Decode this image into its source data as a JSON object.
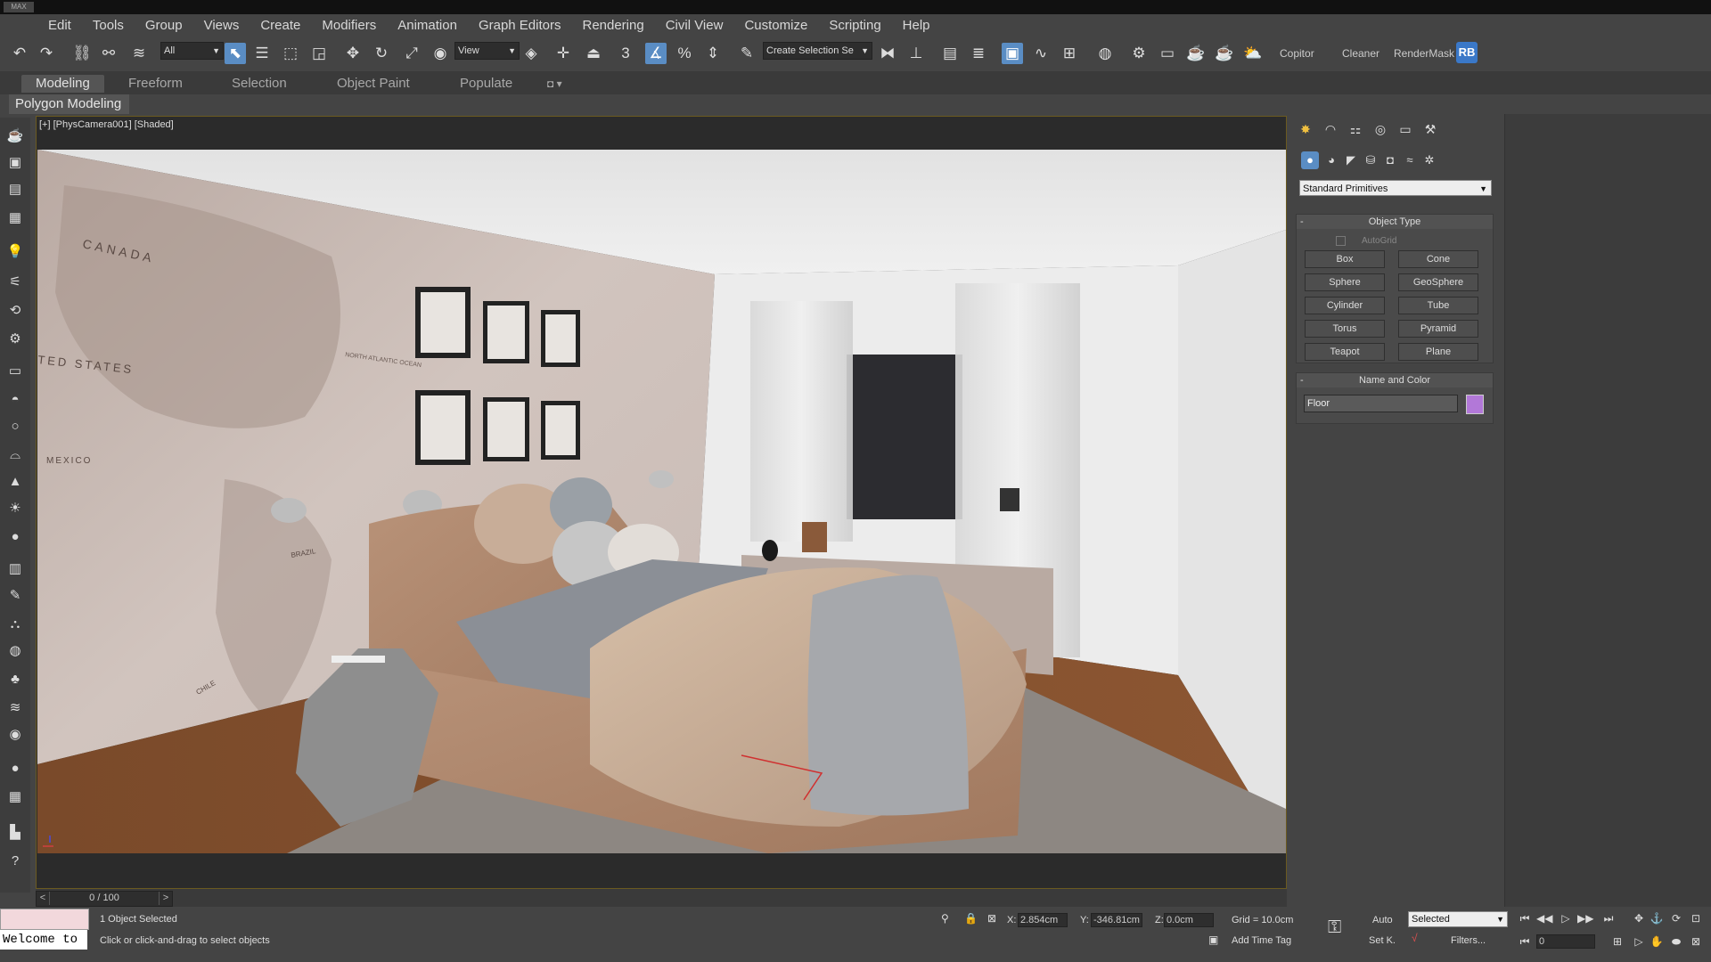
{
  "app": {
    "logo": "MAX"
  },
  "menu": [
    "Edit",
    "Tools",
    "Group",
    "Views",
    "Create",
    "Modifiers",
    "Animation",
    "Graph Editors",
    "Rendering",
    "Civil View",
    "Customize",
    "Scripting",
    "Help"
  ],
  "toolbar": {
    "selection_filter": "All",
    "ref_coord": "View",
    "selection_set_placeholder": "Create Selection Se",
    "snap_label": "3",
    "percent_label": "%",
    "plugins": [
      "Copitor",
      "Cleaner",
      "RenderMask"
    ],
    "rb_label": "RB"
  },
  "ribbon": {
    "tabs": [
      "Modeling",
      "Freeform",
      "Selection",
      "Object Paint",
      "Populate"
    ],
    "active_tab": "Modeling",
    "sub_panel": "Polygon Modeling"
  },
  "viewport": {
    "label": "[+] [PhysCamera001] [Shaded]",
    "map_labels": [
      "CANADA",
      "TED STATES",
      "NORTH ATLANTIC OCEAN",
      "MEXICO",
      "BRAZIL",
      "CHILE"
    ]
  },
  "timeline": {
    "frame": "0 / 100",
    "prev": "<",
    "next": ">"
  },
  "command_panel": {
    "category": "Standard Primitives",
    "object_type": {
      "title": "Object Type",
      "autogrid": "AutoGrid",
      "buttons": [
        "Box",
        "Cone",
        "Sphere",
        "GeoSphere",
        "Cylinder",
        "Tube",
        "Torus",
        "Pyramid",
        "Teapot",
        "Plane"
      ]
    },
    "name_color": {
      "title": "Name and Color",
      "name": "Floor",
      "color": "#b278d8"
    }
  },
  "status": {
    "maxscript": "Welcome to",
    "selected": "1 Object Selected",
    "prompt": "Click or click-and-drag to select objects",
    "x_label": "X:",
    "x": "2.854cm",
    "y_label": "Y:",
    "y": "-346.81cm",
    "z_label": "Z:",
    "z": "0.0cm",
    "grid": "Grid = 10.0cm",
    "add_time_tag": "Add Time Tag",
    "auto": "Auto",
    "selected_drop": "Selected",
    "set_key": "Set K.",
    "filters": "Filters...",
    "frame": "0"
  }
}
